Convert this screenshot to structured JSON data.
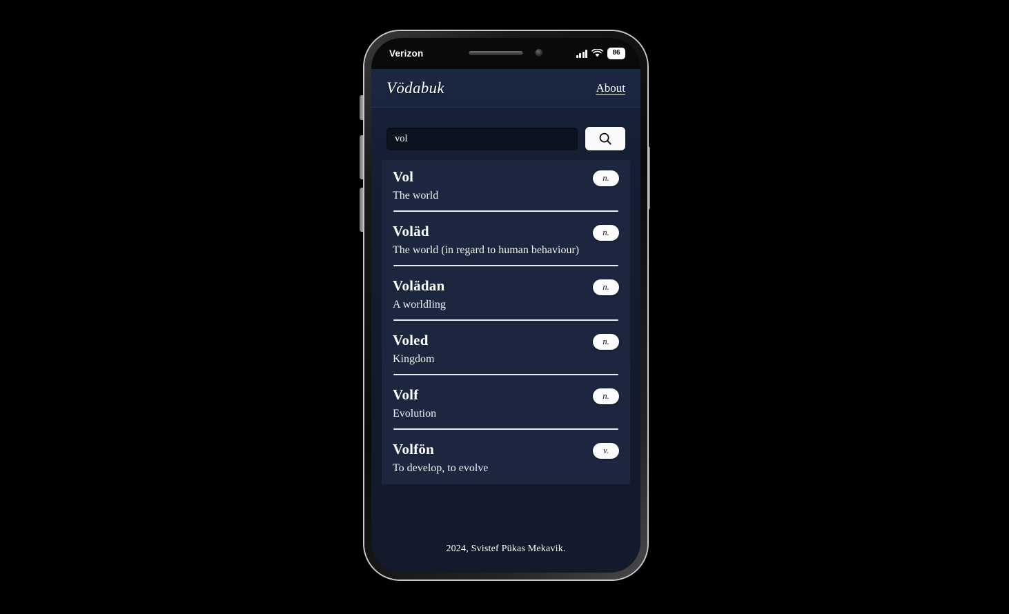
{
  "device": {
    "status_bar": {
      "carrier": "Verizon",
      "battery_level": "86",
      "signal_icon": "cellular-signal-icon",
      "wifi_icon": "wifi-icon",
      "battery_icon": "battery-icon"
    },
    "buttons": {
      "mute_switch": "mute-switch",
      "volume_up": "volume-up-button",
      "volume_down": "volume-down-button",
      "power": "power-button"
    }
  },
  "app": {
    "header": {
      "title": "Vödabuk",
      "about_label": "About"
    },
    "search": {
      "value": "vol",
      "placeholder": "",
      "button_icon": "search-icon"
    },
    "results": [
      {
        "word": "Vol",
        "pos": "n.",
        "definition": "The world"
      },
      {
        "word": "Voläd",
        "pos": "n.",
        "definition": "The world (in regard to human behaviour)"
      },
      {
        "word": "Volädan",
        "pos": "n.",
        "definition": "A worldling"
      },
      {
        "word": "Voled",
        "pos": "n.",
        "definition": "Kingdom"
      },
      {
        "word": "Volf",
        "pos": "n.",
        "definition": "Evolution"
      },
      {
        "word": "Volfön",
        "pos": "v.",
        "definition": "To develop, to evolve"
      }
    ],
    "footer": {
      "text": "2024, Svistef Pükas Mekavik."
    }
  },
  "colors": {
    "page_background": "#121a2c",
    "header_background": "#1a2540",
    "results_background": "#1c273f",
    "accent_white": "#fafafa",
    "divider": "#e9edf5"
  }
}
